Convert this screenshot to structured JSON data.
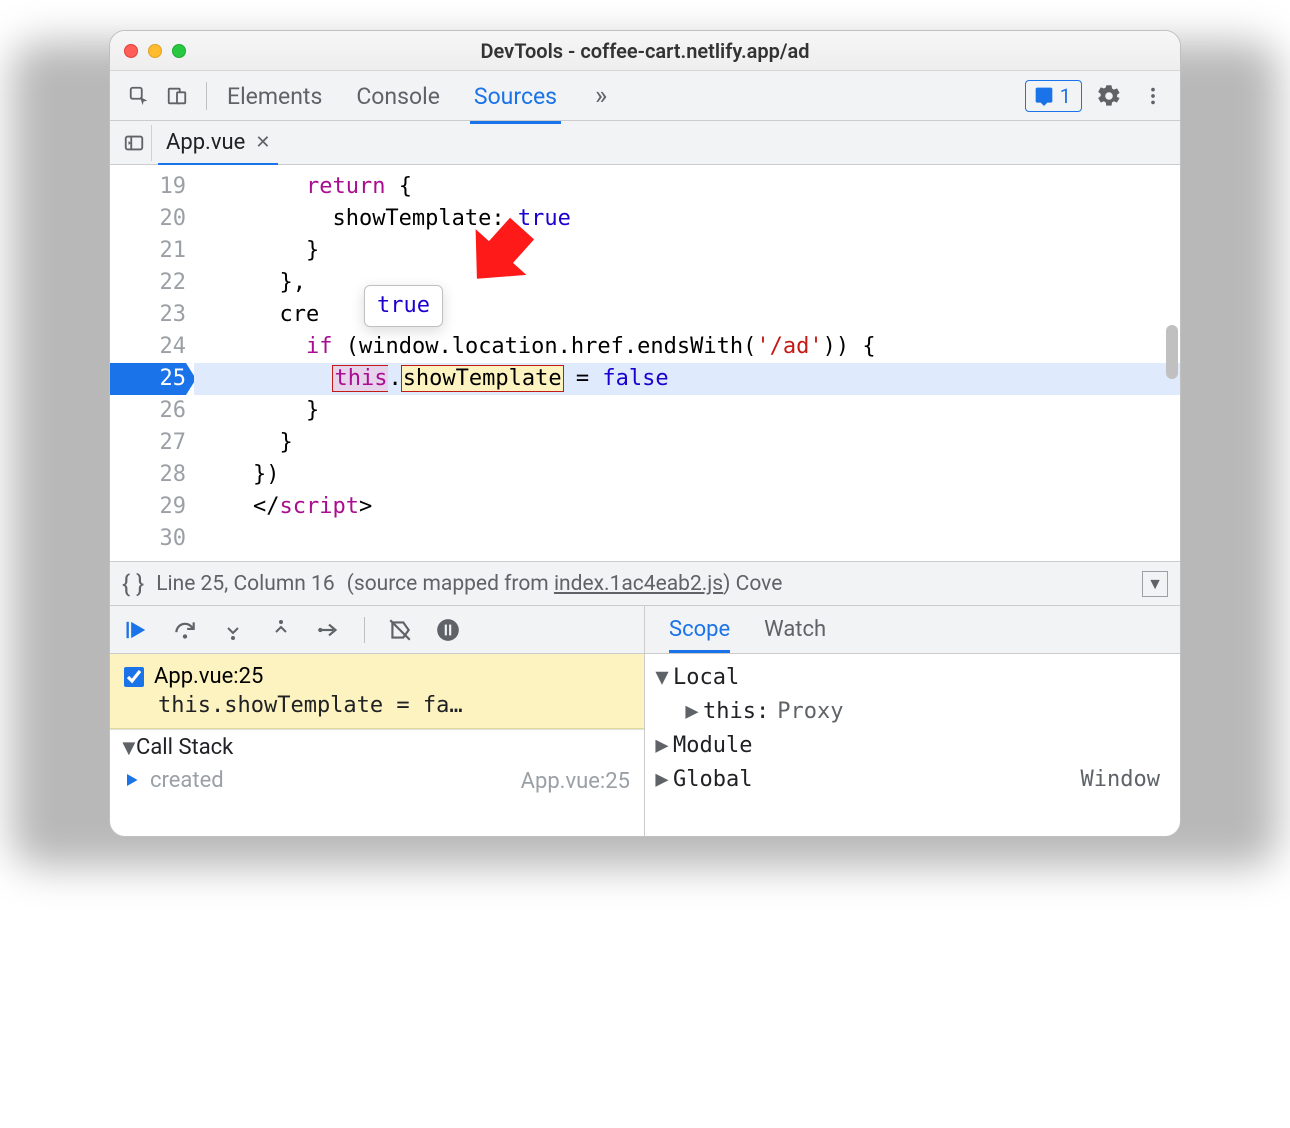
{
  "window_title": "DevTools - coffee-cart.netlify.app/ad",
  "panel_tabs": [
    "Elements",
    "Console",
    "Sources"
  ],
  "active_panel": "Sources",
  "issue_count": "1",
  "file_tab": "App.vue",
  "lines": {
    "l19": {
      "num": "19",
      "indent": "        ",
      "kw": "return",
      "rest": " {"
    },
    "l20": {
      "num": "20",
      "indent": "          ",
      "prop": "showTemplate",
      "sep": ": ",
      "val": "true"
    },
    "l21": {
      "num": "21",
      "indent": "        ",
      "text": "}"
    },
    "l22": {
      "num": "22",
      "indent": "      ",
      "text": "},"
    },
    "l23": {
      "num": "23",
      "indent": "      ",
      "text": "cre        {"
    },
    "l24": {
      "num": "24",
      "indent": "        ",
      "kw": "if",
      "open": " (",
      "obj": "window",
      "rest1": ".location.href.endsWith(",
      "str": "'/ad'",
      "rest2": ")) {"
    },
    "l25": {
      "num": "25",
      "indent": "          ",
      "this": "this",
      "dot": ".",
      "prop": "showTemplate",
      "eq": " = ",
      "val": "false"
    },
    "l26": {
      "num": "26",
      "indent": "        ",
      "text": "}"
    },
    "l27": {
      "num": "27",
      "indent": "      ",
      "text": "}"
    },
    "l28": {
      "num": "28",
      "indent": "    ",
      "text": "})"
    },
    "l29": {
      "num": "29",
      "indent": "    ",
      "open": "</",
      "tag": "script",
      "close": ">"
    },
    "l30": {
      "num": "30",
      "indent": "",
      "text": ""
    }
  },
  "tooltip_value": "true",
  "status": {
    "position": "Line 25, Column 16",
    "mapped_prefix": "(source mapped from ",
    "mapped_file": "index.1ac4eab2.js",
    "mapped_suffix": ") Cove"
  },
  "breakpoint": {
    "file": "App.vue:25",
    "code": "this.showTemplate = fa…"
  },
  "callstack_header": "Call Stack",
  "callstack_frame": {
    "name": "created",
    "src": "App.vue:25"
  },
  "right_tabs": [
    "Scope",
    "Watch"
  ],
  "scope": {
    "local": "Local",
    "this_label": "this",
    "this_value": "Proxy",
    "module": "Module",
    "global": "Global",
    "global_obj": "Window"
  }
}
